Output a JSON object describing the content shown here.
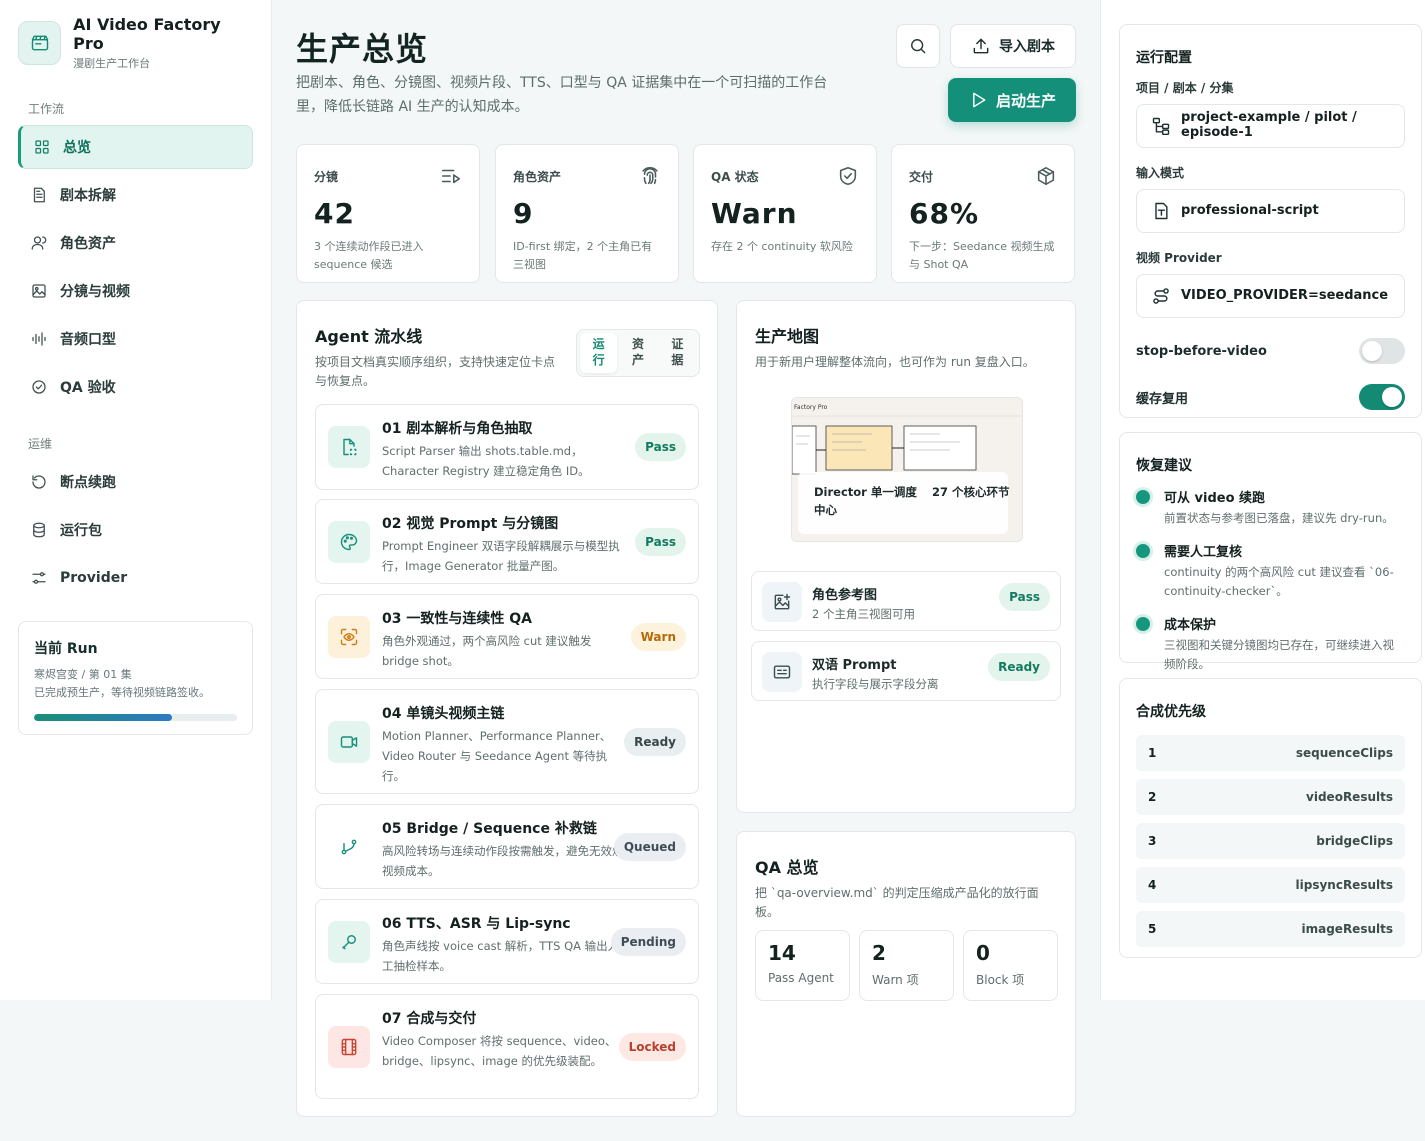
{
  "app": {
    "title": "AI Video Factory Pro",
    "subtitle": "漫剧生产工作台"
  },
  "sidebar": {
    "section1": "工作流",
    "section2": "运维",
    "items": [
      {
        "label": "总览",
        "icon": "grid-icon",
        "active": true
      },
      {
        "label": "剧本拆解",
        "icon": "document-icon"
      },
      {
        "label": "角色资产",
        "icon": "user-icon"
      },
      {
        "label": "分镜与视频",
        "icon": "image-icon"
      },
      {
        "label": "音频口型",
        "icon": "audio-wave-icon"
      },
      {
        "label": "QA 验收",
        "icon": "check-circle-icon"
      }
    ],
    "ops_items": [
      {
        "label": "断点续跑",
        "icon": "restart-icon"
      },
      {
        "label": "运行包",
        "icon": "database-icon"
      },
      {
        "label": "Provider",
        "icon": "sliders-icon"
      }
    ]
  },
  "current_run": {
    "title": "当前 Run",
    "line1": "寒烬宫变 / 第 01 集",
    "line2": "已完成预生产，等待视频链路签收。",
    "progress": 0.68
  },
  "header": {
    "title": "生产总览",
    "description": "把剧本、角色、分镜图、视频片段、TTS、口型与 QA 证据集中在一个可扫描的工作台里，降低长链路 AI 生产的认知成本。",
    "import_label": "导入剧本",
    "start_label": "启动生产"
  },
  "stats": [
    {
      "label": "分镜",
      "value": "42",
      "note": "3 个连续动作段已进入 sequence 候选",
      "icon": "list-play-icon"
    },
    {
      "label": "角色资产",
      "value": "9",
      "note": "ID-first 绑定，2 个主角已有三视图",
      "icon": "fingerprint-icon"
    },
    {
      "label": "QA 状态",
      "value": "Warn",
      "note": "存在 2 个 continuity 软风险",
      "icon": "shield-check-icon"
    },
    {
      "label": "交付",
      "value": "68%",
      "note": "下一步：Seedance 视频生成与 Shot QA",
      "icon": "package-icon"
    }
  ],
  "pipeline": {
    "title": "Agent 流水线",
    "description": "按项目文档真实顺序组织，支持快速定位卡点与恢复点。",
    "tabs": [
      "运行",
      "资产",
      "证据"
    ],
    "steps": [
      {
        "title": "01 剧本解析与角色抽取",
        "desc": "Script Parser 输出 shots.table.md，Character Registry 建立稳定角色 ID。",
        "status": "Pass",
        "icon": "file-scan-icon"
      },
      {
        "title": "02 视觉 Prompt 与分镜图",
        "desc": "Prompt Engineer 双语字段解耦展示与模型执行，Image Generator 批量产图。",
        "status": "Pass",
        "icon": "palette-icon"
      },
      {
        "title": "03 一致性与连续性 QA",
        "desc": "角色外观通过，两个高风险 cut 建议触发 bridge shot。",
        "status": "Warn",
        "icon": "eye-scan-icon"
      },
      {
        "title": "04 单镜头视频主链",
        "desc": "Motion Planner、Performance Planner、Video Router 与 Seedance Agent 等待执行。",
        "status": "Ready",
        "icon": "video-icon"
      },
      {
        "title": "05 Bridge / Sequence 补救链",
        "desc": "高风险转场与连续动作段按需触发，避免无效烧视频成本。",
        "status": "Queued",
        "icon": "git-branch-icon"
      },
      {
        "title": "06 TTS、ASR 与 Lip-sync",
        "desc": "角色声线按 voice cast 解析，TTS QA 输出人工抽检样本。",
        "status": "Pending",
        "icon": "microphone-icon"
      },
      {
        "title": "07 合成与交付",
        "desc": "Video Composer 将按 sequence、video、bridge、lipsync、image 的优先级装配。",
        "status": "Locked",
        "icon": "film-icon"
      }
    ]
  },
  "map": {
    "title": "生产地图",
    "description": "用于新用户理解整体流向，也可作为 run 复盘入口。",
    "thumb_header": "Factory Pro",
    "thumb_caption1": "Director 单一调度中心",
    "thumb_caption2": "27 个核心环节",
    "cards": [
      {
        "title": "角色参考图",
        "sub": "2 个主角三视图可用",
        "status": "Pass",
        "icon": "image-plus-icon"
      },
      {
        "title": "双语 Prompt",
        "sub": "执行字段与展示字段分离",
        "status": "Ready",
        "icon": "text-card-icon"
      }
    ]
  },
  "qa_overview": {
    "title": "QA 总览",
    "description": "把 `qa-overview.md` 的判定压缩成产品化的放行面板。",
    "boxes": [
      {
        "num": "14",
        "label": "Pass Agent"
      },
      {
        "num": "2",
        "label": "Warn 项"
      },
      {
        "num": "0",
        "label": "Block 项"
      }
    ]
  },
  "config": {
    "title": "运行配置",
    "project_label": "项目 / 剧本 / 分集",
    "project_value": "project-example / pilot / episode-1",
    "input_label": "输入模式",
    "input_value": "professional-script",
    "provider_label": "视频 Provider",
    "provider_value": "VIDEO_PROVIDER=seedance",
    "toggles": [
      {
        "label": "stop-before-video",
        "on": false
      },
      {
        "label": "缓存复用",
        "on": true
      }
    ]
  },
  "recovery": {
    "title": "恢复建议",
    "items": [
      {
        "title": "可从 video 续跑",
        "desc": "前置状态与参考图已落盘，建议先 dry-run。"
      },
      {
        "title": "需要人工复核",
        "desc": "continuity 的两个高风险 cut 建议查看 `06-continuity-checker`。"
      },
      {
        "title": "成本保护",
        "desc": "三视图和关键分镜图均已存在，可继续进入视频阶段。"
      }
    ]
  },
  "priority": {
    "title": "合成优先级",
    "items": [
      {
        "n": "1",
        "name": "sequenceClips"
      },
      {
        "n": "2",
        "name": "videoResults"
      },
      {
        "n": "3",
        "name": "bridgeClips"
      },
      {
        "n": "4",
        "name": "lipsyncResults"
      },
      {
        "n": "5",
        "name": "imageResults"
      }
    ]
  },
  "colors": {
    "accent": "#14907a",
    "warn": "#d27b12",
    "danger": "#c94634"
  }
}
